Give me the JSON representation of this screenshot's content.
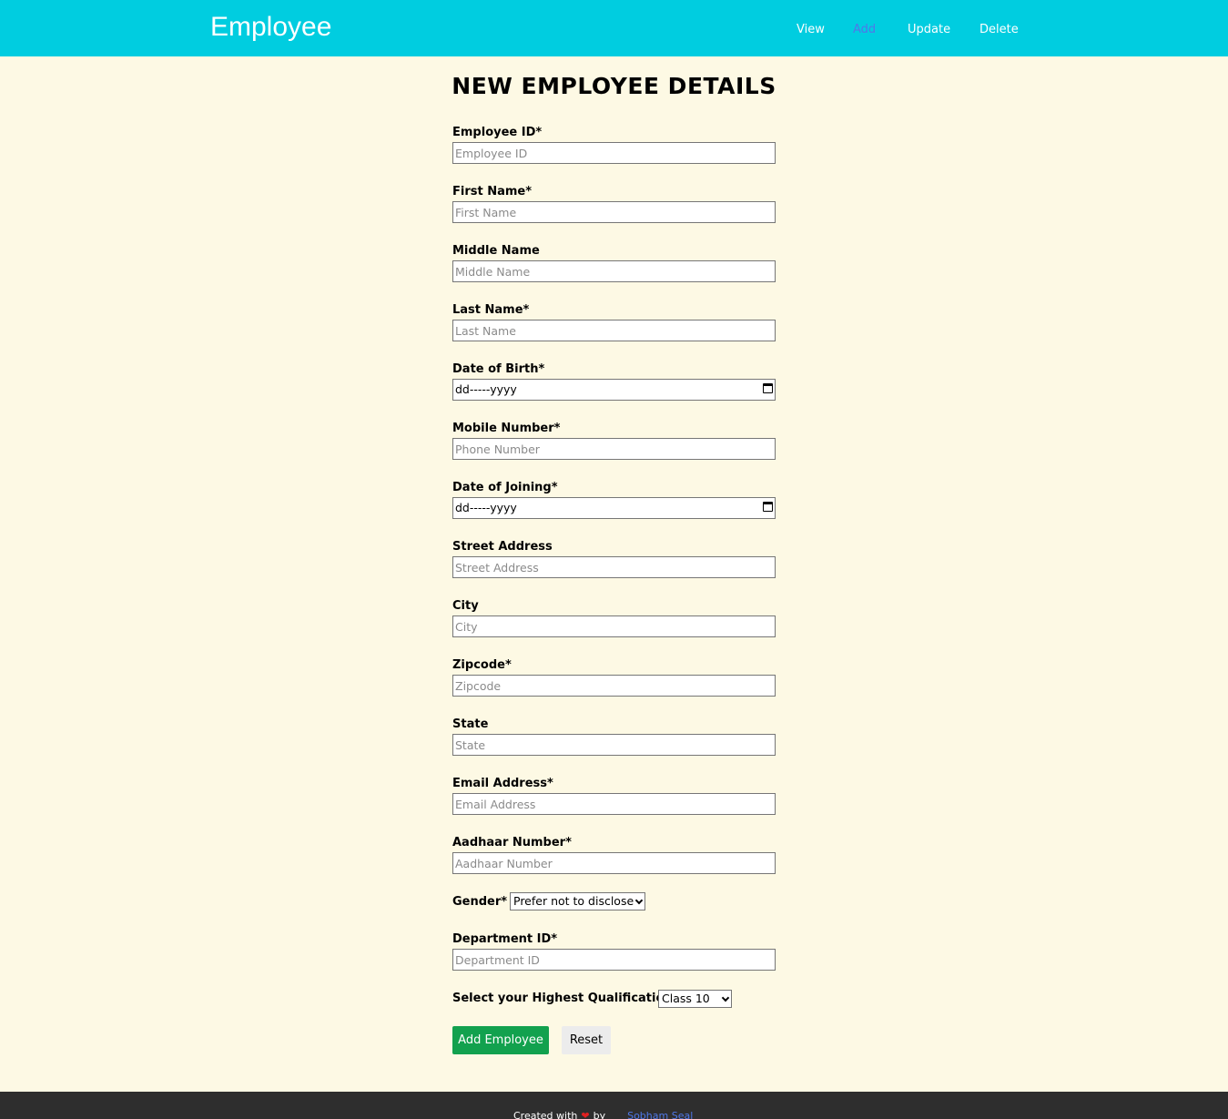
{
  "navbar": {
    "brand": "Employee",
    "links": [
      "View",
      "Add",
      "Update",
      "Delete"
    ],
    "active": "Add",
    "bg_color": "#00cde0",
    "active_color": "#4f78e8"
  },
  "form": {
    "title": "NEW EMPLOYEE DETAILS",
    "fields": {
      "employee_id": {
        "label": "Employee ID*",
        "placeholder": "Employee ID"
      },
      "first_name": {
        "label": "First Name*",
        "placeholder": "First Name"
      },
      "middle_name": {
        "label": "Middle Name",
        "placeholder": "Middle Name"
      },
      "last_name": {
        "label": "Last Name*",
        "placeholder": "Last Name"
      },
      "dob": {
        "label": "Date of Birth*",
        "value": "dd-----yyyy"
      },
      "mobile": {
        "label": "Mobile Number*",
        "placeholder": "Phone Number"
      },
      "doj": {
        "label": "Date of Joining*",
        "value": "dd-----yyyy"
      },
      "street": {
        "label": "Street Address",
        "placeholder": "Street Address"
      },
      "city": {
        "label": "City",
        "placeholder": "City"
      },
      "zipcode": {
        "label": "Zipcode*",
        "placeholder": "Zipcode"
      },
      "state": {
        "label": "State",
        "placeholder": "State"
      },
      "email": {
        "label": "Email Address*",
        "placeholder": "Email Address"
      },
      "aadhaar": {
        "label": "Aadhaar Number*",
        "placeholder": "Aadhaar Number"
      },
      "gender": {
        "label": "Gender*",
        "selected": "Prefer not to disclose"
      },
      "department": {
        "label": "Department ID*",
        "placeholder": "Department ID"
      },
      "qualification": {
        "label": "Select your Highest Qualification*",
        "selected": "Class 10"
      }
    },
    "buttons": {
      "add": "Add Employee",
      "reset": "Reset",
      "add_color": "#12a14e"
    }
  },
  "footer": {
    "text_before": "Created with",
    "heart_icon": "heart-icon",
    "text_by": "by",
    "author": "Sobham Seal"
  }
}
